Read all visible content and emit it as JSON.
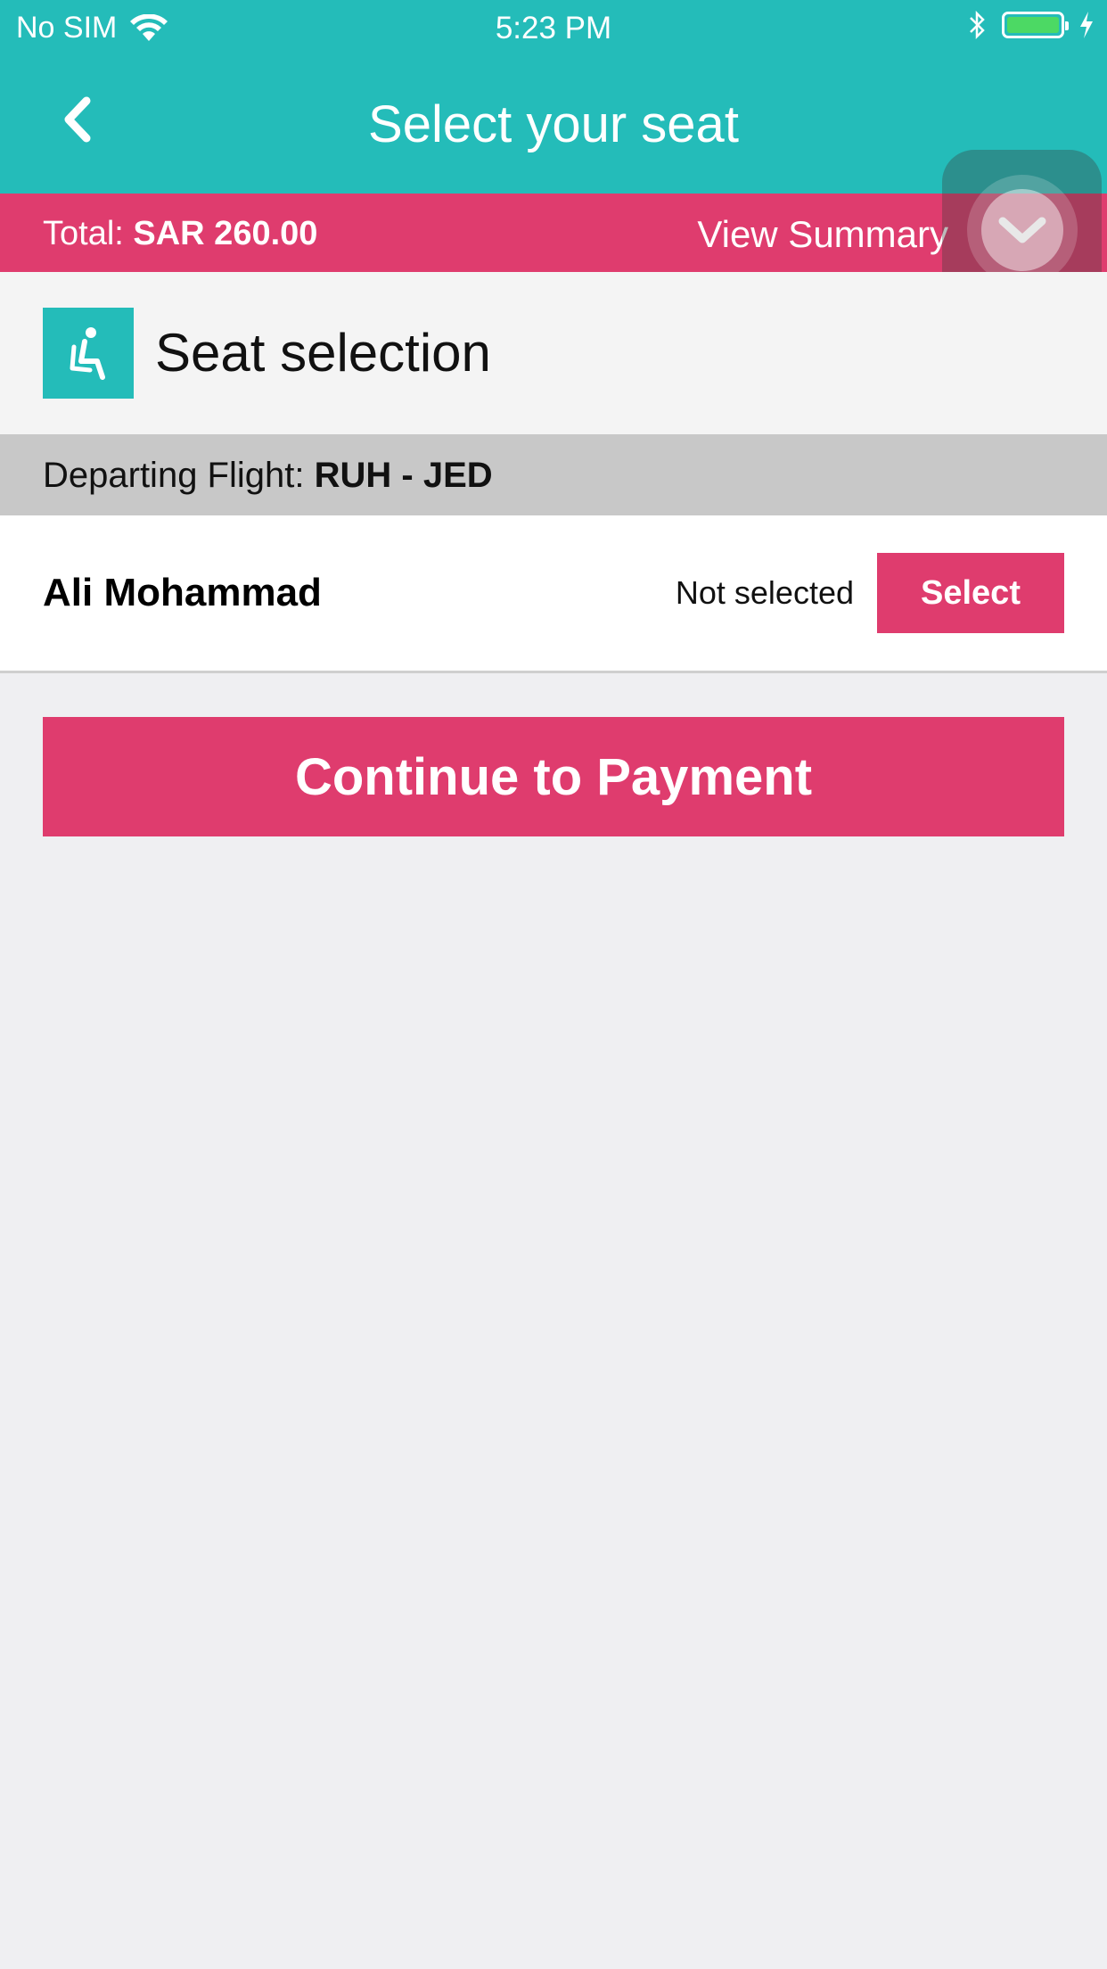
{
  "status_bar": {
    "carrier": "No SIM",
    "time": "5:23 PM",
    "battery_level": 1.0
  },
  "nav": {
    "title": "Select your seat",
    "back_icon": "chevron-left-icon"
  },
  "total_bar": {
    "label": "Total:",
    "amount": "SAR 260.00",
    "view_summary": "View Summary"
  },
  "section": {
    "title": "Seat selection",
    "icon": "seat-icon"
  },
  "flight": {
    "label": "Departing Flight:",
    "route": "RUH - JED"
  },
  "passenger": {
    "name": "Ali Mohammad",
    "seat_status": "Not selected",
    "select_label": "Select"
  },
  "continue_label": "Continue to Payment",
  "colors": {
    "teal": "#24bcb9",
    "pink": "#df3c6e",
    "background": "#efeff2"
  }
}
